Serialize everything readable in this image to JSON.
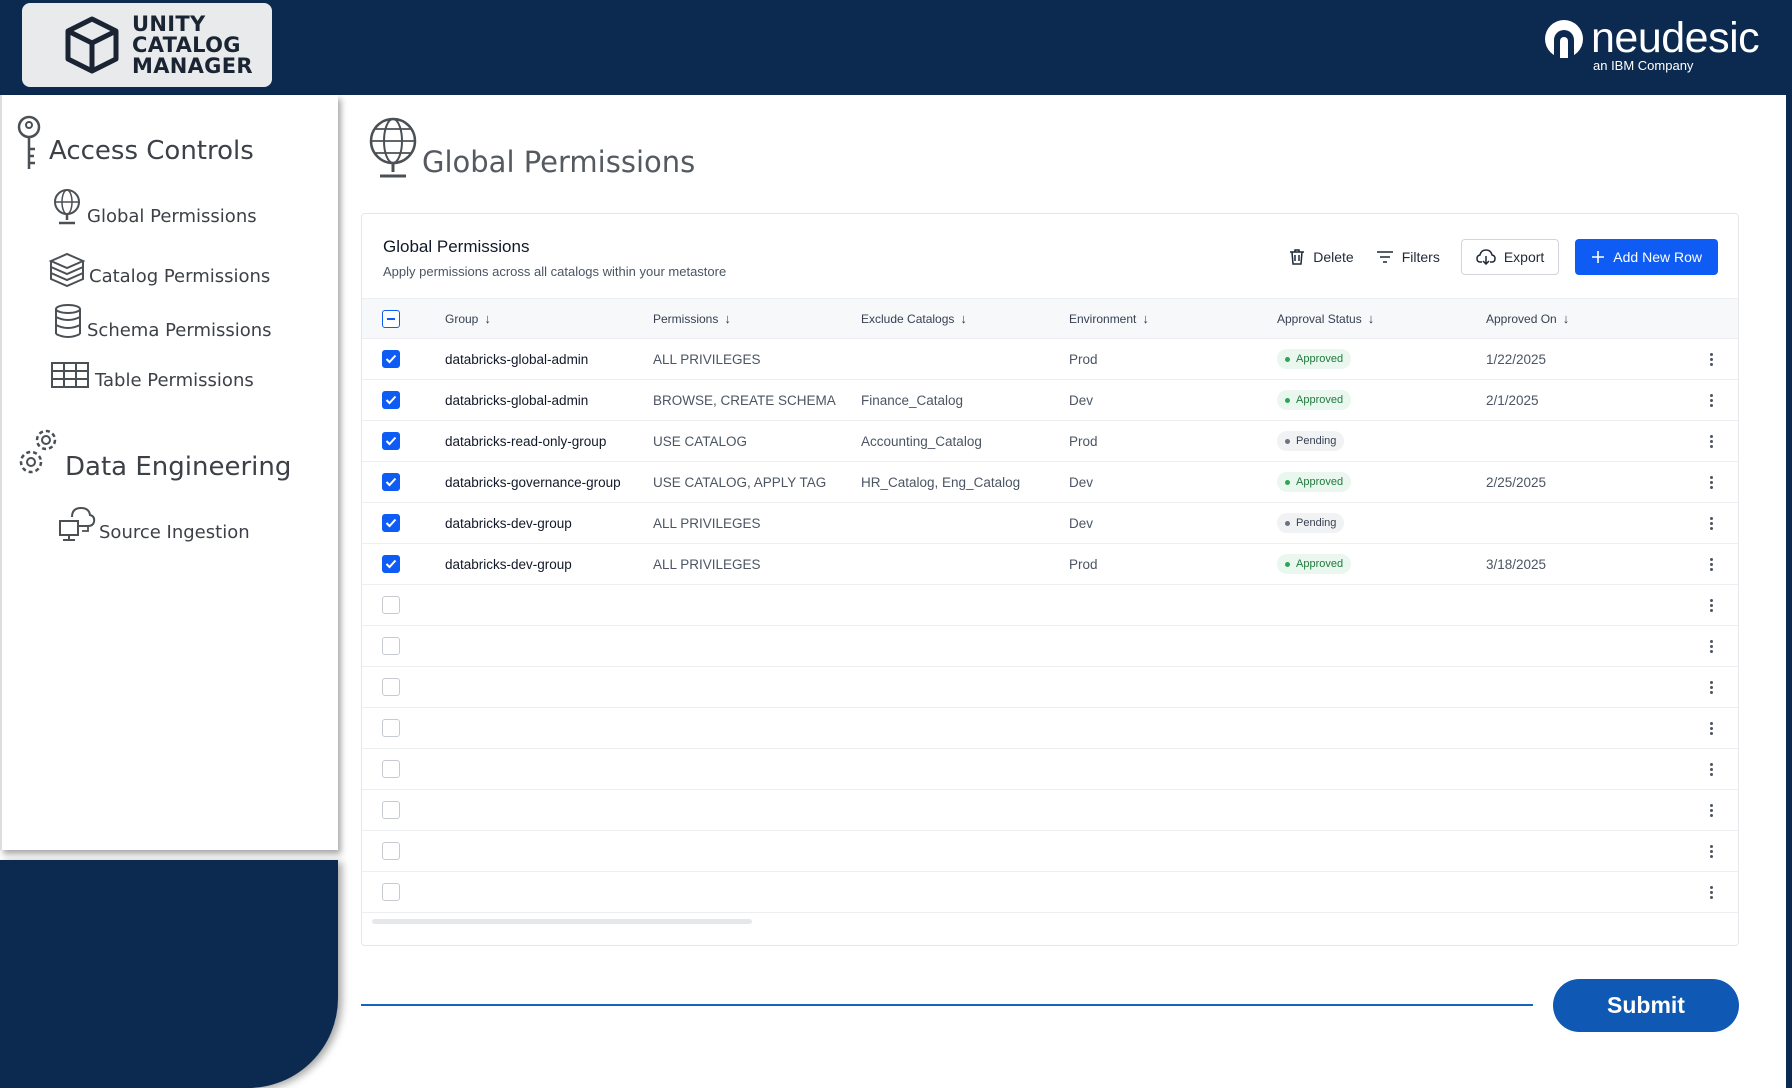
{
  "header": {
    "logo_text": [
      "UNITY",
      "CATALOG",
      "MANAGER"
    ],
    "brand_name": "neudesic",
    "brand_sub": "an IBM Company"
  },
  "sidebar": {
    "sections": [
      {
        "title": "Access Controls",
        "icon": "key-icon",
        "items": [
          {
            "label": "Global Permissions",
            "icon": "globe-icon"
          },
          {
            "label": "Catalog Permissions",
            "icon": "stack-icon"
          },
          {
            "label": "Schema Permissions",
            "icon": "database-icon"
          },
          {
            "label": "Table Permissions",
            "icon": "table-icon"
          }
        ]
      },
      {
        "title": "Data Engineering",
        "icon": "gears-icon",
        "items": [
          {
            "label": "Source Ingestion",
            "icon": "cloud-sync-icon"
          }
        ]
      }
    ]
  },
  "page": {
    "title": "Global Permissions",
    "icon": "globe-icon"
  },
  "card": {
    "title": "Global Permissions",
    "subtitle": "Apply permissions across all catalogs within your metastore",
    "toolbar": {
      "delete_label": "Delete",
      "filters_label": "Filters",
      "export_label": "Export",
      "add_label": "Add New Row"
    },
    "columns": [
      "Group",
      "Permissions",
      "Exclude Catalogs",
      "Environment",
      "Approval Status",
      "Approved On"
    ],
    "rows": [
      {
        "checked": true,
        "group": "databricks-global-admin",
        "permissions": "ALL PRIVILEGES",
        "exclude": "",
        "environment": "Prod",
        "status": "Approved",
        "approved_on": "1/22/2025"
      },
      {
        "checked": true,
        "group": "databricks-global-admin",
        "permissions": "BROWSE, CREATE SCHEMA",
        "exclude": "Finance_Catalog",
        "environment": "Dev",
        "status": "Approved",
        "approved_on": "2/1/2025"
      },
      {
        "checked": true,
        "group": "databricks-read-only-group",
        "permissions": "USE CATALOG",
        "exclude": "Accounting_Catalog",
        "environment": "Prod",
        "status": "Pending",
        "approved_on": ""
      },
      {
        "checked": true,
        "group": "databricks-governance-group",
        "permissions": "USE CATALOG, APPLY TAG",
        "exclude": "HR_Catalog, Eng_Catalog",
        "environment": "Dev",
        "status": "Approved",
        "approved_on": "2/25/2025"
      },
      {
        "checked": true,
        "group": "databricks-dev-group",
        "permissions": "ALL PRIVILEGES",
        "exclude": "",
        "environment": "Dev",
        "status": "Pending",
        "approved_on": ""
      },
      {
        "checked": true,
        "group": "databricks-dev-group",
        "permissions": "ALL PRIVILEGES",
        "exclude": "",
        "environment": "Prod",
        "status": "Approved",
        "approved_on": "3/18/2025"
      },
      {
        "checked": false,
        "group": "",
        "permissions": "",
        "exclude": "",
        "environment": "",
        "status": "",
        "approved_on": ""
      },
      {
        "checked": false,
        "group": "",
        "permissions": "",
        "exclude": "",
        "environment": "",
        "status": "",
        "approved_on": ""
      },
      {
        "checked": false,
        "group": "",
        "permissions": "",
        "exclude": "",
        "environment": "",
        "status": "",
        "approved_on": ""
      },
      {
        "checked": false,
        "group": "",
        "permissions": "",
        "exclude": "",
        "environment": "",
        "status": "",
        "approved_on": ""
      },
      {
        "checked": false,
        "group": "",
        "permissions": "",
        "exclude": "",
        "environment": "",
        "status": "",
        "approved_on": ""
      },
      {
        "checked": false,
        "group": "",
        "permissions": "",
        "exclude": "",
        "environment": "",
        "status": "",
        "approved_on": ""
      },
      {
        "checked": false,
        "group": "",
        "permissions": "",
        "exclude": "",
        "environment": "",
        "status": "",
        "approved_on": ""
      },
      {
        "checked": false,
        "group": "",
        "permissions": "",
        "exclude": "",
        "environment": "",
        "status": "",
        "approved_on": ""
      }
    ]
  },
  "submit_label": "Submit",
  "colors": {
    "navy": "#0c2a4f",
    "primary": "#0f5cf5",
    "submit": "#0f58b3",
    "approved": "#2ea556"
  }
}
